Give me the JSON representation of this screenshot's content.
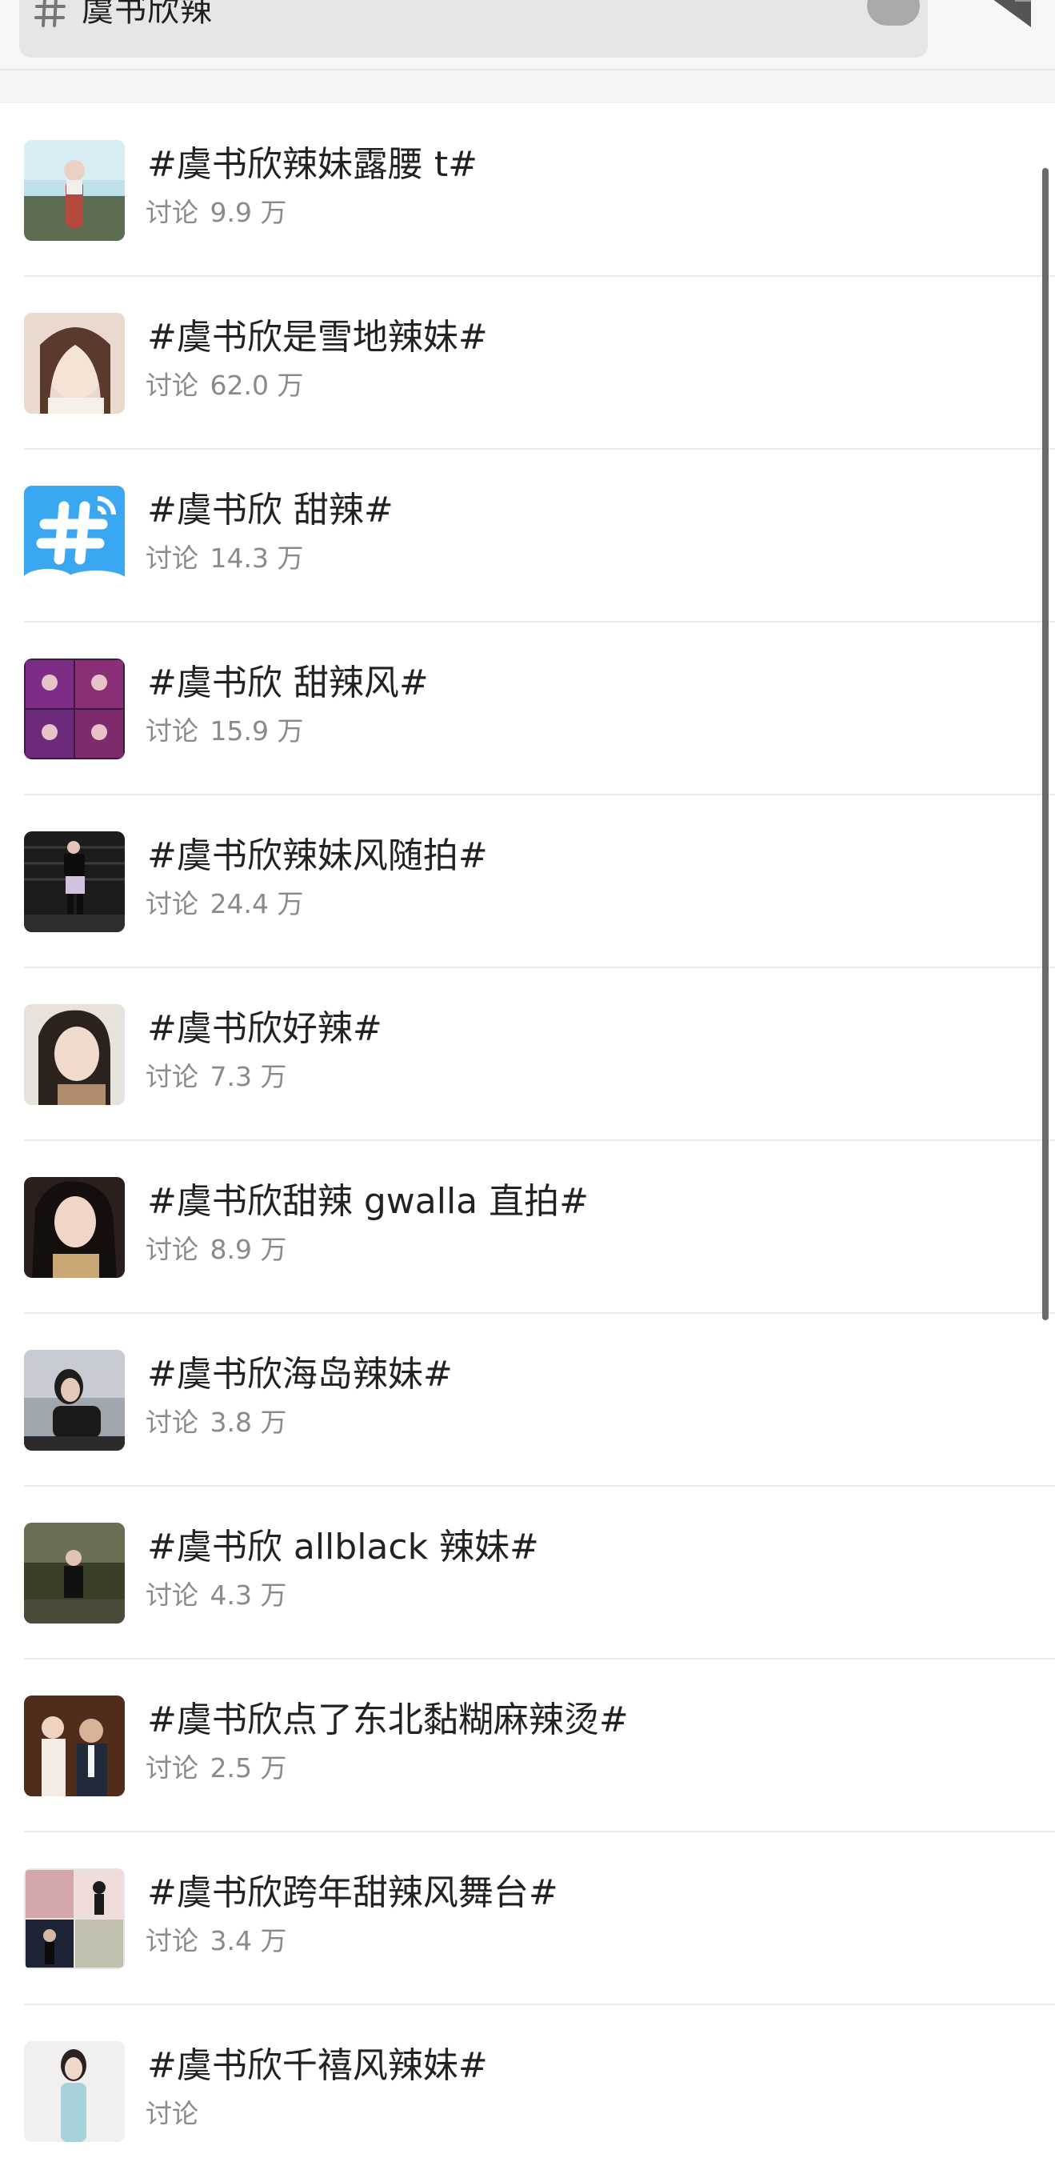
{
  "search": {
    "query": "虞书欣辣",
    "icon": "hash-icon"
  },
  "topics": [
    {
      "title": "#虞书欣辣妹露腰 t#",
      "label": "讨论",
      "count": "9.9 万"
    },
    {
      "title": "#虞书欣是雪地辣妹#",
      "label": "讨论",
      "count": "62.0 万"
    },
    {
      "title": "#虞书欣 甜辣#",
      "label": "讨论",
      "count": "14.3 万"
    },
    {
      "title": "#虞书欣 甜辣风#",
      "label": "讨论",
      "count": "15.9 万"
    },
    {
      "title": "#虞书欣辣妹风随拍#",
      "label": "讨论",
      "count": "24.4 万"
    },
    {
      "title": "#虞书欣好辣#",
      "label": "讨论",
      "count": "7.3 万"
    },
    {
      "title": "#虞书欣甜辣 gwalla 直拍#",
      "label": "讨论",
      "count": "8.9 万"
    },
    {
      "title": "#虞书欣海岛辣妹#",
      "label": "讨论",
      "count": "3.8 万"
    },
    {
      "title": "#虞书欣 allblack 辣妹#",
      "label": "讨论",
      "count": "4.3 万"
    },
    {
      "title": "#虞书欣点了东北黏糊麻辣烫#",
      "label": "讨论",
      "count": "2.5 万"
    },
    {
      "title": "#虞书欣跨年甜辣风舞台#",
      "label": "讨论",
      "count": "3.4 万"
    },
    {
      "title": "#虞书欣千禧风辣妹#",
      "label": "讨论",
      "count": ""
    }
  ],
  "colors": {
    "accent_blue": "#3aa7f2",
    "subtext": "#8a8a8a",
    "divider": "#ececec"
  }
}
